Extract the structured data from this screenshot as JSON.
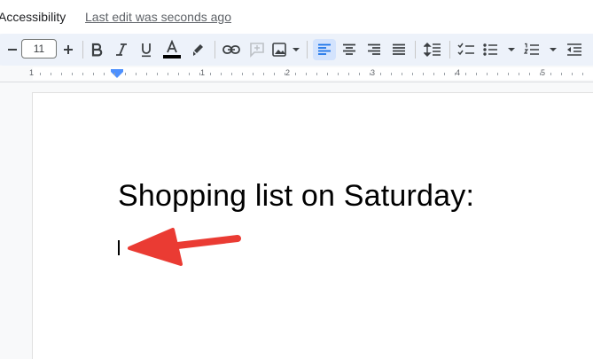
{
  "menubar": {
    "accessibility_label": "Accessibility",
    "last_edit_label": "Last edit was seconds ago"
  },
  "toolbar": {
    "font_size_value": "11",
    "items": [
      "decrease-font-size",
      "font-size",
      "increase-font-size",
      "bold",
      "italic",
      "underline",
      "text-color",
      "highlight",
      "insert-link",
      "add-comment",
      "insert-image",
      "align-left",
      "align-center",
      "align-right",
      "justify",
      "line-spacing",
      "checklist",
      "bulleted-list",
      "numbered-list",
      "decrease-indent"
    ],
    "text_color_swatch": "#000000",
    "accent_color": "#1a73e8"
  },
  "ruler": {
    "labels": [
      "1",
      "1",
      "2",
      "3",
      "4",
      "5"
    ]
  },
  "document": {
    "heading": "Shopping list on Saturday:"
  },
  "annotation": {
    "arrow_color": "#ea3b33"
  }
}
